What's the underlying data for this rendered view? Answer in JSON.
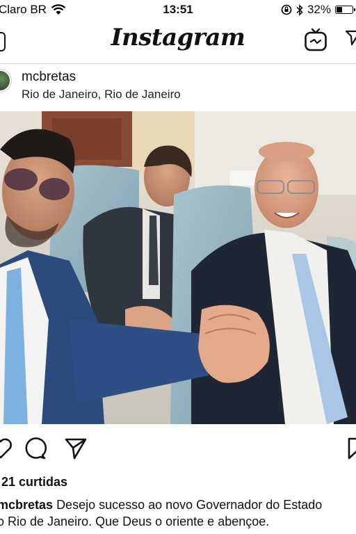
{
  "status_bar": {
    "carrier": "Claro BR",
    "time": "13:51",
    "battery": "32%",
    "battery_level": 0.32
  },
  "nav": {
    "logo": "Instagram"
  },
  "post": {
    "username": "mcbretas",
    "location": "Rio de Janeiro, Rio de Janeiro",
    "likes": "21 curtidas",
    "caption_user": "mcbretas",
    "caption_line1": "Desejo sucesso ao novo Governador do Estado",
    "caption_line2": "o Rio de Janeiro. Que Deus o oriente e abençoe."
  },
  "icons": {
    "camera": "camera-icon",
    "igtv": "igtv-icon",
    "direct": "direct-icon",
    "like": "heart-icon",
    "comment": "comment-icon",
    "share": "share-icon",
    "save": "bookmark-icon"
  }
}
